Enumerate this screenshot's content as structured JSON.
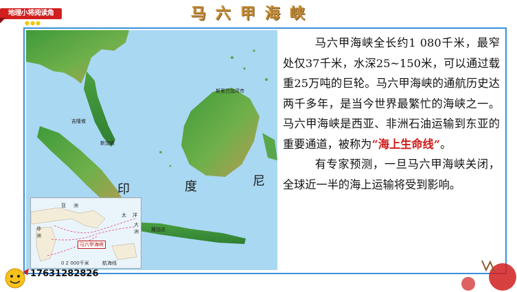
{
  "header": {
    "badge_label": "地理小将阅读角",
    "title": "马六甲海峡"
  },
  "map": {
    "seas": [
      "印",
      "度",
      "尼"
    ],
    "places": [
      "吉隆坡",
      "新加坡",
      "斯里巴加湾市",
      "雅加达"
    ],
    "inset": {
      "labels": [
        "亚",
        "洲",
        "非",
        "洲",
        "太",
        "洋",
        "大",
        "洲"
      ],
      "tag": "马六甲海峡",
      "scale": "0  2 000千米",
      "legend": "航海线"
    }
  },
  "text": {
    "p1_part1": "马六甲海峡全长约1 080千米，最窄处仅37千米，水深25~150米，可以通过载重25万吨的巨轮。马六甲海峡的通航历史达两千多年，是当今世界最繁忙的海峡之一。马六甲海峡是西亚、非洲石油运输到东亚的重要通道，被称为",
    "p1_highlight": "“海上生命线”",
    "p1_end": "。",
    "p2": "有专家预测，一旦马六甲海峡关闭，全球近一半的海上运输将受到影响。"
  },
  "footer": {
    "phone": "17631282826"
  },
  "colors": {
    "frame": "#3a8fd9",
    "highlight": "#d01919",
    "title": "#c08a3a",
    "badge": "#d11f1f"
  }
}
